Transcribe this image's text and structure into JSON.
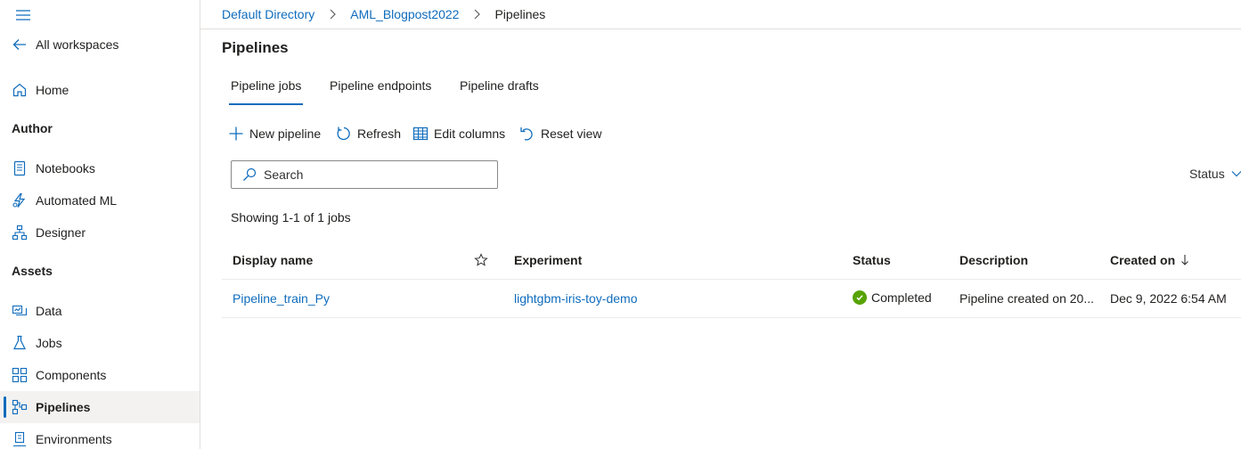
{
  "sidebar": {
    "all_workspaces": "All workspaces",
    "home": "Home",
    "author_section": "Author",
    "notebooks": "Notebooks",
    "automated_ml": "Automated ML",
    "designer": "Designer",
    "assets_section": "Assets",
    "data": "Data",
    "jobs": "Jobs",
    "components": "Components",
    "pipelines": "Pipelines",
    "environments": "Environments"
  },
  "breadcrumb": {
    "items": [
      "Default Directory",
      "AML_Blogpost2022",
      "Pipelines"
    ]
  },
  "page": {
    "title": "Pipelines"
  },
  "tabs": [
    {
      "label": "Pipeline jobs",
      "active": true
    },
    {
      "label": "Pipeline endpoints",
      "active": false
    },
    {
      "label": "Pipeline drafts",
      "active": false
    }
  ],
  "toolbar": {
    "new_pipeline": "New pipeline",
    "refresh": "Refresh",
    "edit_columns": "Edit columns",
    "reset_view": "Reset view"
  },
  "search": {
    "placeholder": "Search",
    "value": ""
  },
  "filter": {
    "status_label": "Status"
  },
  "summary": {
    "showing": "Showing 1-1 of 1 jobs"
  },
  "table": {
    "columns": {
      "display_name": "Display name",
      "experiment": "Experiment",
      "status": "Status",
      "description": "Description",
      "created_on": "Created on"
    },
    "rows": [
      {
        "display_name": "Pipeline_train_Py",
        "experiment": "lightgbm-iris-toy-demo",
        "status": "Completed",
        "description": "Pipeline created on 20...",
        "created_on": "Dec 9, 2022 6:54 AM"
      }
    ]
  },
  "colors": {
    "accent": "#0f6cbd",
    "success": "#57a300",
    "text": "#201f1e",
    "divider": "#e1dfdd"
  }
}
